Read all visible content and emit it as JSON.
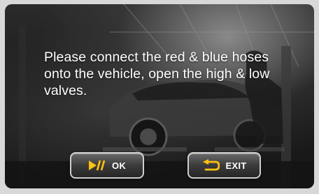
{
  "dialog": {
    "message": "Please connect the red & blue hoses onto the vehicle, open the high & low valves."
  },
  "buttons": {
    "ok": {
      "label": "OK",
      "icon": "play-pause-icon"
    },
    "exit": {
      "label": "EXIT",
      "icon": "return-arrow-icon"
    }
  },
  "colors": {
    "icon_accent": "#ffc20e",
    "text": "#ffffff"
  }
}
